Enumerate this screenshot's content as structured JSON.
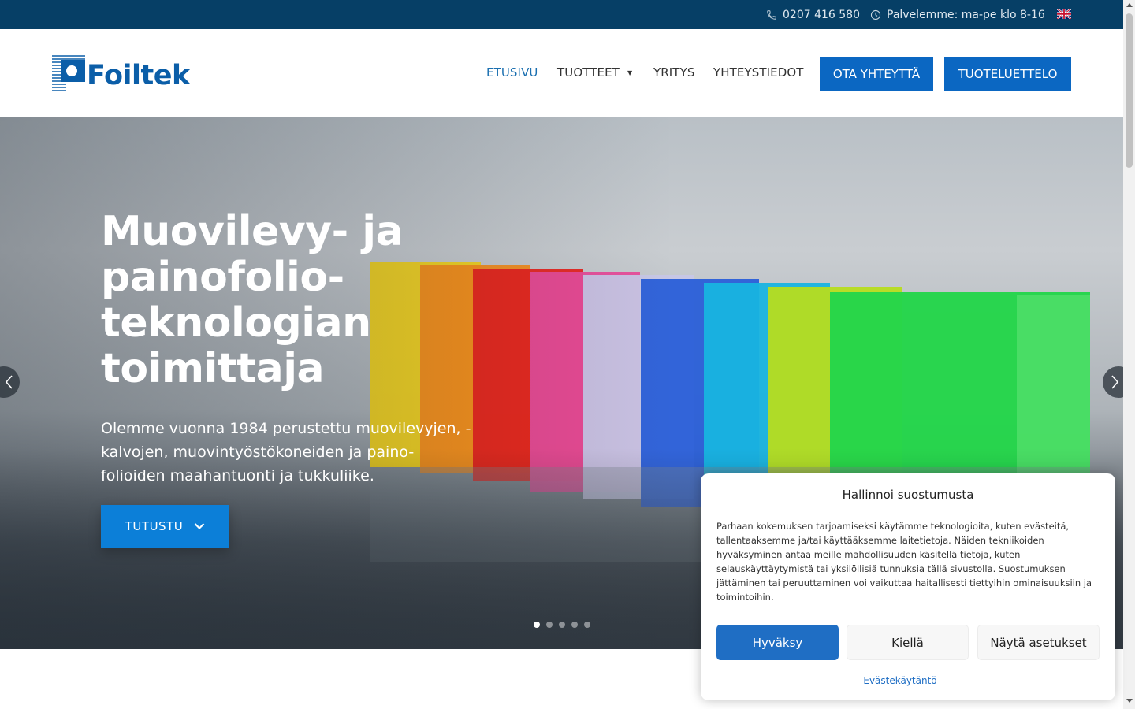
{
  "topbar": {
    "phone": "0207 416 580",
    "hours": "Palvelemme: ma-pe klo 8-16",
    "phone_icon": "phone-icon",
    "clock_icon": "clock-icon",
    "language_flag": "uk-flag-icon"
  },
  "header": {
    "logo_text": "Foiltek",
    "nav": [
      {
        "label": "ETUSIVU",
        "active": true
      },
      {
        "label": "TUOTTEET",
        "has_dropdown": true
      },
      {
        "label": "YRITYS"
      },
      {
        "label": "YHTEYSTIEDOT"
      }
    ],
    "cta_contact": "OTA YHTEYTTÄ",
    "cta_catalog": "TUOTELUETTELO"
  },
  "hero": {
    "title": "Muovilevy- ja painofolio-teknologian toimittaja",
    "title_lines": [
      "Muovilevy- ja",
      "painofolio-",
      "teknologian",
      "toimittaja"
    ],
    "subtitle": "Olemme vuonna 1984 perustettu muovilevyjen, -kalvojen,  muovintyöstökoneiden ja paino-folioiden maahantuonti ja tukkuliike.",
    "subtitle_lines": [
      "Olemme vuonna 1984 perustettu muovilevyjen, -",
      "kalvojen,  muovintyöstökoneiden ja paino-",
      "folioiden maahantuonti ja tukkuliike."
    ],
    "button": "TUTUSTU",
    "slides_total": 5,
    "active_slide": 1
  },
  "consent": {
    "title": "Hallinnoi suostumusta",
    "text": "Parhaan kokemuksen tarjoamiseksi käytämme teknologioita, kuten evästeitä, tallentaaksemme ja/tai käyttääksemme laitetietoja. Näiden tekniikoiden hyväksyminen antaa meille mahdollisuuden käsitellä tietoja, kuten selauskäyttäytymistä tai yksilöllisiä tunnuksia tällä sivustolla. Suostumuksen jättäminen tai peruuttaminen voi vaikuttaa haitallisesti tiettyihin ominaisuuksiin ja toimintoihin.",
    "accept": "Hyväksy",
    "deny": "Kiellä",
    "settings": "Näytä asetukset",
    "policy_link": "Evästekäytäntö"
  },
  "colors": {
    "topbar": "#063f66",
    "brand_blue": "#0b67c2",
    "active_nav": "#1a6fb0",
    "accept_button": "#1f6ec4"
  }
}
